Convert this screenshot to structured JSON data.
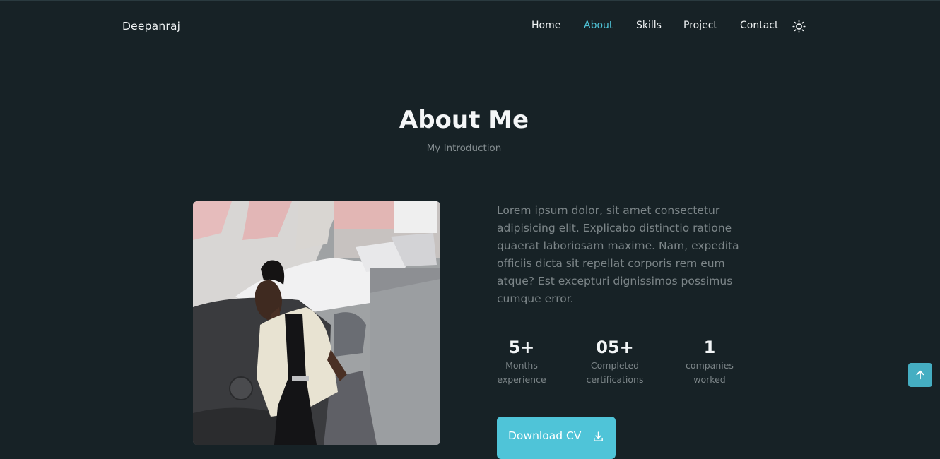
{
  "header": {
    "logo": "Deepanraj",
    "nav": [
      {
        "label": "Home",
        "active": false
      },
      {
        "label": "About",
        "active": true
      },
      {
        "label": "Skills",
        "active": false
      },
      {
        "label": "Project",
        "active": false
      },
      {
        "label": "Contact",
        "active": false
      }
    ],
    "theme_icon": "sun-icon"
  },
  "about": {
    "title": "About Me",
    "subtitle": "My Introduction",
    "description": "Lorem ipsum dolor, sit amet consectetur adipisicing elit. Explicabo distinctio ratione quaerat laboriosam maxime. Nam, expedita officiis dicta sit repellat corporis rem eum atque? Est excepturi dignissimos possimus cumque error.",
    "stats": [
      {
        "number": "5+",
        "label_line1": "Months",
        "label_line2": "experience"
      },
      {
        "number": "05+",
        "label_line1": "Completed",
        "label_line2": "certifications"
      },
      {
        "number": "1",
        "label_line1": "companies",
        "label_line2": "worked"
      }
    ],
    "cv_button": {
      "label": "Download CV",
      "icon": "download-icon"
    }
  },
  "scroll_up": {
    "icon": "arrow-up-icon"
  },
  "colors": {
    "background": "#172226",
    "accent": "#4fc4d8",
    "text": "#f2f5f6",
    "muted": "#7c8588",
    "scroll_button": "#45aec2"
  }
}
